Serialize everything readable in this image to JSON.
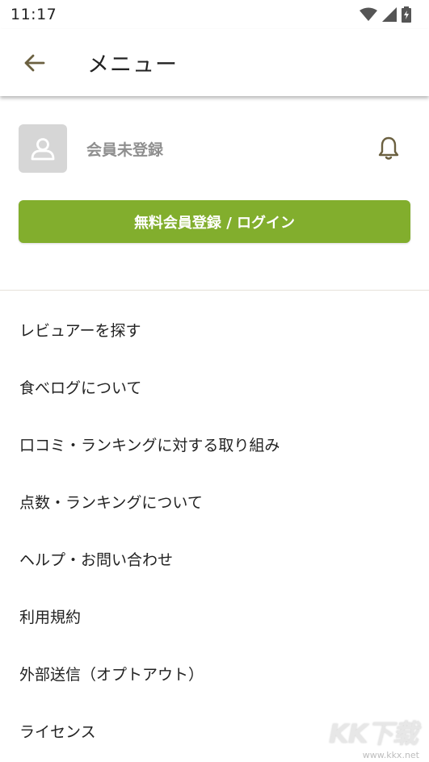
{
  "status_bar": {
    "time": "11:17"
  },
  "app_bar": {
    "title": "メニュー"
  },
  "profile": {
    "guest_label": "会員未登録"
  },
  "login_button": {
    "label": "無料会員登録 / ログイン"
  },
  "menu": {
    "items": [
      {
        "label": "レビュアーを探す"
      },
      {
        "label": "食べログについて"
      },
      {
        "label": "口コミ・ランキングに対する取り組み"
      },
      {
        "label": "点数・ランキングについて"
      },
      {
        "label": "ヘルプ・お問い合わせ"
      },
      {
        "label": "利用規約"
      },
      {
        "label": "外部送信（オプトアウト）"
      },
      {
        "label": "ライセンス"
      }
    ]
  },
  "watermark": {
    "logo_text": "KK下载",
    "url": "www.kkx.net"
  },
  "colors": {
    "accent_green": "#82ae2d",
    "icon_olive": "#6b6040",
    "avatar_bg": "#d6d6d6"
  }
}
